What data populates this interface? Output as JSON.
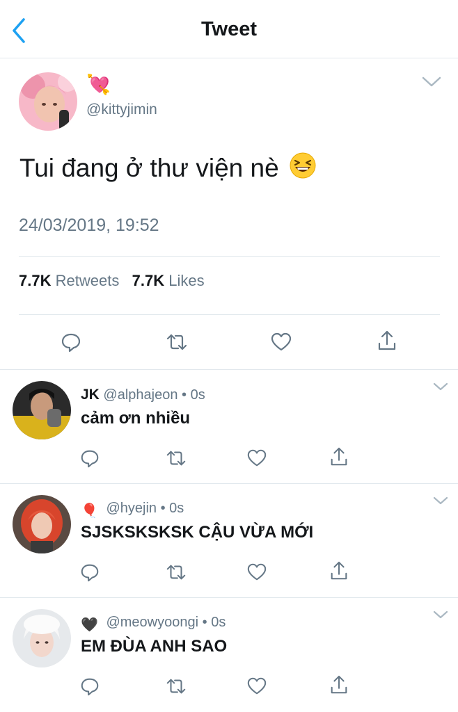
{
  "header": {
    "title": "Tweet"
  },
  "tweet": {
    "author_emoji": "💘",
    "handle": "@kittyjimin",
    "text": "Tui đang ở thư viện nè",
    "datetime": "24/03/2019, 19:52",
    "retweets_count": "7.7K",
    "retweets_label": "Retweets",
    "likes_count": "7.7K",
    "likes_label": "Likes"
  },
  "replies": [
    {
      "name": "JK",
      "handle": "@alphajeon",
      "time": "0s",
      "text": "cảm ơn nhiều"
    },
    {
      "name_emoji": "🎈",
      "handle": "@hyejin",
      "time": "0s",
      "text": "SJSKSKSKSK CẬU VỪA MỚI"
    },
    {
      "name_emoji": "🖤",
      "handle": "@meowyoongi",
      "time": "0s",
      "text": "EM ĐÙA ANH SAO"
    }
  ],
  "separator": "•",
  "colors": {
    "accent": "#1da1f2",
    "text": "#14171a",
    "secondary": "#657786",
    "divider": "#e1e8ed"
  }
}
